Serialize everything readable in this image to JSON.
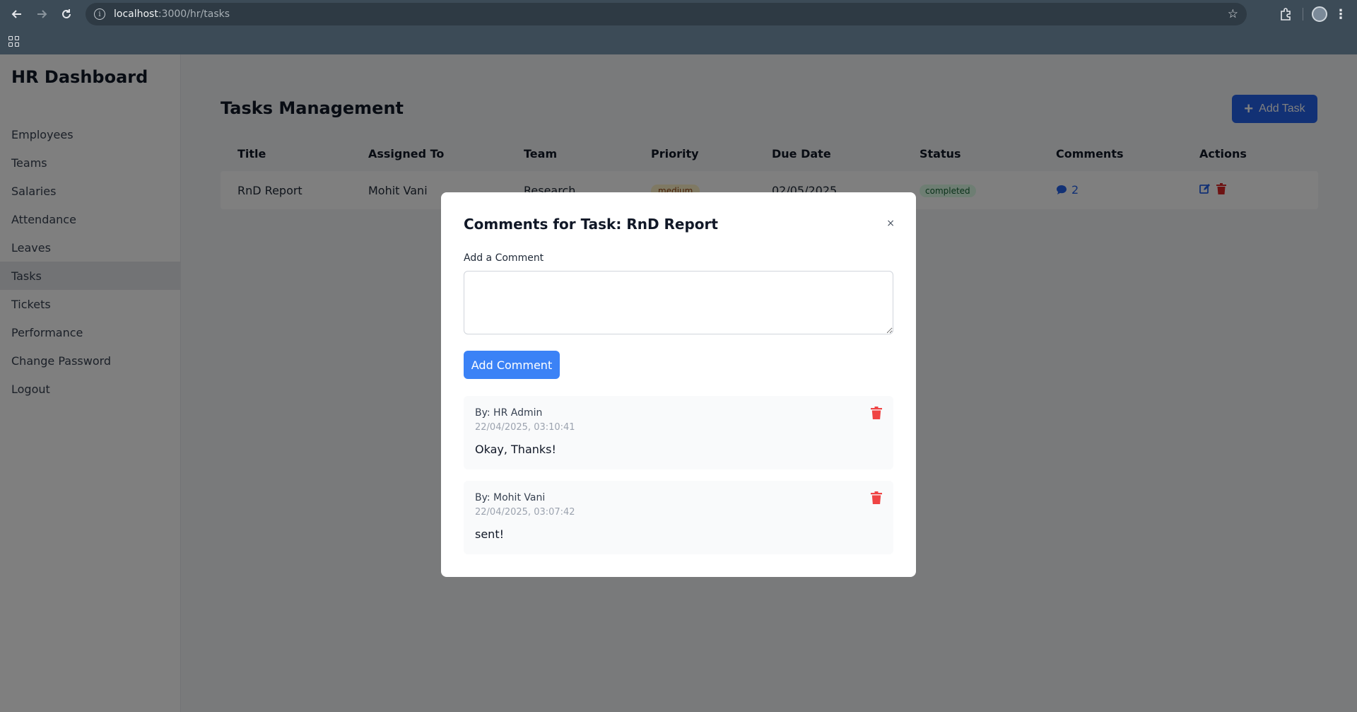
{
  "browser": {
    "url_host": "localhost",
    "url_path": ":3000/hr/tasks"
  },
  "sidebar": {
    "brand": "HR Dashboard",
    "items": [
      {
        "label": "Employees"
      },
      {
        "label": "Teams"
      },
      {
        "label": "Salaries"
      },
      {
        "label": "Attendance"
      },
      {
        "label": "Leaves"
      },
      {
        "label": "Tasks",
        "active": true
      },
      {
        "label": "Tickets"
      },
      {
        "label": "Performance"
      },
      {
        "label": "Change Password"
      },
      {
        "label": "Logout"
      }
    ]
  },
  "main": {
    "title": "Tasks Management",
    "add_task_label": "Add Task",
    "table": {
      "headers": [
        "Title",
        "Assigned To",
        "Team",
        "Priority",
        "Due Date",
        "Status",
        "Comments",
        "Actions"
      ],
      "rows": [
        {
          "title": "RnD Report",
          "assigned_to": "Mohit Vani",
          "team": "Research",
          "priority": "medium",
          "due_date": "02/05/2025",
          "status": "completed",
          "comment_count": "2"
        }
      ]
    }
  },
  "modal": {
    "title": "Comments for Task: RnD Report",
    "close_symbol": "×",
    "field_label": "Add a Comment",
    "textarea_value": "",
    "submit_label": "Add Comment",
    "comments": [
      {
        "author": "By: HR Admin",
        "timestamp": "22/04/2025, 03:10:41",
        "text": "Okay, Thanks!"
      },
      {
        "author": "By: Mohit Vani",
        "timestamp": "22/04/2025, 03:07:42",
        "text": "sent!"
      }
    ]
  },
  "colors": {
    "primary": "#2563eb",
    "button_blue": "#3b82f6",
    "delete_red": "#ef4444",
    "status_green_bg": "#dcfce7",
    "overlay": "rgba(0,0,0,0.5)"
  }
}
